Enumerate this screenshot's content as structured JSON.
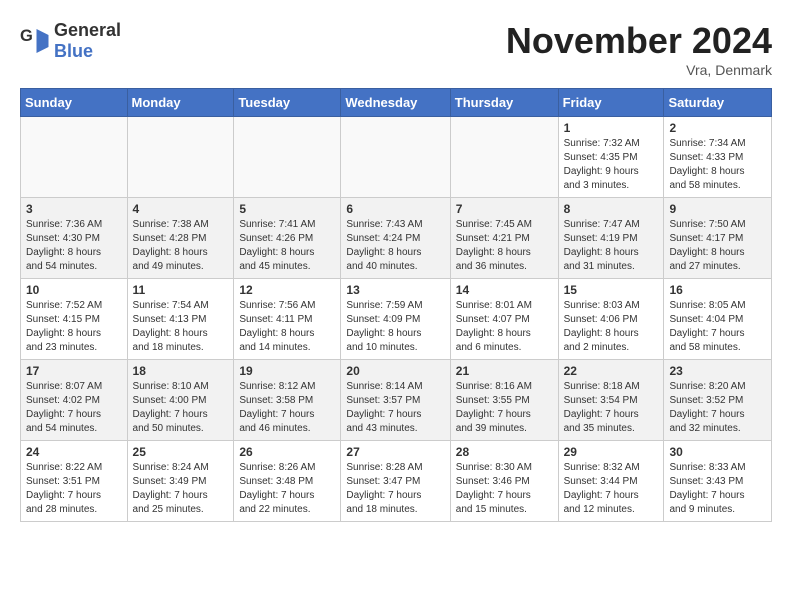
{
  "app": {
    "name_general": "General",
    "name_blue": "Blue"
  },
  "title": "November 2024",
  "location": "Vra, Denmark",
  "days_of_week": [
    "Sunday",
    "Monday",
    "Tuesday",
    "Wednesday",
    "Thursday",
    "Friday",
    "Saturday"
  ],
  "weeks": [
    [
      {
        "day": null,
        "info": ""
      },
      {
        "day": null,
        "info": ""
      },
      {
        "day": null,
        "info": ""
      },
      {
        "day": null,
        "info": ""
      },
      {
        "day": null,
        "info": ""
      },
      {
        "day": "1",
        "info": "Sunrise: 7:32 AM\nSunset: 4:35 PM\nDaylight: 9 hours\nand 3 minutes."
      },
      {
        "day": "2",
        "info": "Sunrise: 7:34 AM\nSunset: 4:33 PM\nDaylight: 8 hours\nand 58 minutes."
      }
    ],
    [
      {
        "day": "3",
        "info": "Sunrise: 7:36 AM\nSunset: 4:30 PM\nDaylight: 8 hours\nand 54 minutes."
      },
      {
        "day": "4",
        "info": "Sunrise: 7:38 AM\nSunset: 4:28 PM\nDaylight: 8 hours\nand 49 minutes."
      },
      {
        "day": "5",
        "info": "Sunrise: 7:41 AM\nSunset: 4:26 PM\nDaylight: 8 hours\nand 45 minutes."
      },
      {
        "day": "6",
        "info": "Sunrise: 7:43 AM\nSunset: 4:24 PM\nDaylight: 8 hours\nand 40 minutes."
      },
      {
        "day": "7",
        "info": "Sunrise: 7:45 AM\nSunset: 4:21 PM\nDaylight: 8 hours\nand 36 minutes."
      },
      {
        "day": "8",
        "info": "Sunrise: 7:47 AM\nSunset: 4:19 PM\nDaylight: 8 hours\nand 31 minutes."
      },
      {
        "day": "9",
        "info": "Sunrise: 7:50 AM\nSunset: 4:17 PM\nDaylight: 8 hours\nand 27 minutes."
      }
    ],
    [
      {
        "day": "10",
        "info": "Sunrise: 7:52 AM\nSunset: 4:15 PM\nDaylight: 8 hours\nand 23 minutes."
      },
      {
        "day": "11",
        "info": "Sunrise: 7:54 AM\nSunset: 4:13 PM\nDaylight: 8 hours\nand 18 minutes."
      },
      {
        "day": "12",
        "info": "Sunrise: 7:56 AM\nSunset: 4:11 PM\nDaylight: 8 hours\nand 14 minutes."
      },
      {
        "day": "13",
        "info": "Sunrise: 7:59 AM\nSunset: 4:09 PM\nDaylight: 8 hours\nand 10 minutes."
      },
      {
        "day": "14",
        "info": "Sunrise: 8:01 AM\nSunset: 4:07 PM\nDaylight: 8 hours\nand 6 minutes."
      },
      {
        "day": "15",
        "info": "Sunrise: 8:03 AM\nSunset: 4:06 PM\nDaylight: 8 hours\nand 2 minutes."
      },
      {
        "day": "16",
        "info": "Sunrise: 8:05 AM\nSunset: 4:04 PM\nDaylight: 7 hours\nand 58 minutes."
      }
    ],
    [
      {
        "day": "17",
        "info": "Sunrise: 8:07 AM\nSunset: 4:02 PM\nDaylight: 7 hours\nand 54 minutes."
      },
      {
        "day": "18",
        "info": "Sunrise: 8:10 AM\nSunset: 4:00 PM\nDaylight: 7 hours\nand 50 minutes."
      },
      {
        "day": "19",
        "info": "Sunrise: 8:12 AM\nSunset: 3:58 PM\nDaylight: 7 hours\nand 46 minutes."
      },
      {
        "day": "20",
        "info": "Sunrise: 8:14 AM\nSunset: 3:57 PM\nDaylight: 7 hours\nand 43 minutes."
      },
      {
        "day": "21",
        "info": "Sunrise: 8:16 AM\nSunset: 3:55 PM\nDaylight: 7 hours\nand 39 minutes."
      },
      {
        "day": "22",
        "info": "Sunrise: 8:18 AM\nSunset: 3:54 PM\nDaylight: 7 hours\nand 35 minutes."
      },
      {
        "day": "23",
        "info": "Sunrise: 8:20 AM\nSunset: 3:52 PM\nDaylight: 7 hours\nand 32 minutes."
      }
    ],
    [
      {
        "day": "24",
        "info": "Sunrise: 8:22 AM\nSunset: 3:51 PM\nDaylight: 7 hours\nand 28 minutes."
      },
      {
        "day": "25",
        "info": "Sunrise: 8:24 AM\nSunset: 3:49 PM\nDaylight: 7 hours\nand 25 minutes."
      },
      {
        "day": "26",
        "info": "Sunrise: 8:26 AM\nSunset: 3:48 PM\nDaylight: 7 hours\nand 22 minutes."
      },
      {
        "day": "27",
        "info": "Sunrise: 8:28 AM\nSunset: 3:47 PM\nDaylight: 7 hours\nand 18 minutes."
      },
      {
        "day": "28",
        "info": "Sunrise: 8:30 AM\nSunset: 3:46 PM\nDaylight: 7 hours\nand 15 minutes."
      },
      {
        "day": "29",
        "info": "Sunrise: 8:32 AM\nSunset: 3:44 PM\nDaylight: 7 hours\nand 12 minutes."
      },
      {
        "day": "30",
        "info": "Sunrise: 8:33 AM\nSunset: 3:43 PM\nDaylight: 7 hours\nand 9 minutes."
      }
    ]
  ]
}
